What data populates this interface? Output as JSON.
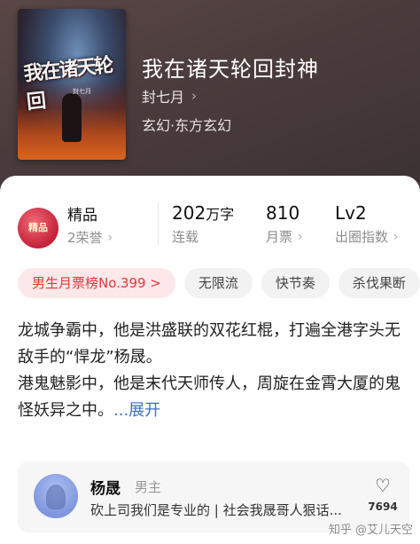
{
  "book": {
    "cover_badge": "",
    "cover_title_art": "我在诸天轮回",
    "cover_subtitle_art": "封七月",
    "title": "我在诸天轮回封神",
    "author": "封七月",
    "genre": "玄幻·东方玄幻"
  },
  "stats": {
    "quality_badge": "精品",
    "quality_label": "精品",
    "honors": "2荣誉",
    "word_count": "202",
    "word_unit": "万字",
    "word_status": "连载",
    "monthly_votes": "810",
    "monthly_votes_label": "月票",
    "level": "Lv2",
    "level_label": "出圈指数"
  },
  "tags": [
    "男生月票榜No.399 >",
    "无限流",
    "快节奏",
    "杀伐果断"
  ],
  "description": {
    "line1": "龙城争霸中，他是洪盛联的双花红棍，打遍全港字头无敌手的“悍龙”杨晟。",
    "line2": "港鬼魅影中，他是末代天师传人，周旋在金霄大厦的鬼怪妖异之中。",
    "expand": "...展开"
  },
  "character": {
    "name": "杨晟",
    "role": "男主",
    "quote": "砍上司我们是专业的 | 社会我晟哥人狠话...",
    "likes": "7694"
  },
  "watermark": "知乎 @艾儿天空",
  "icons": {
    "author_chevron": "chevron-right-icon",
    "like": "heart-icon"
  }
}
